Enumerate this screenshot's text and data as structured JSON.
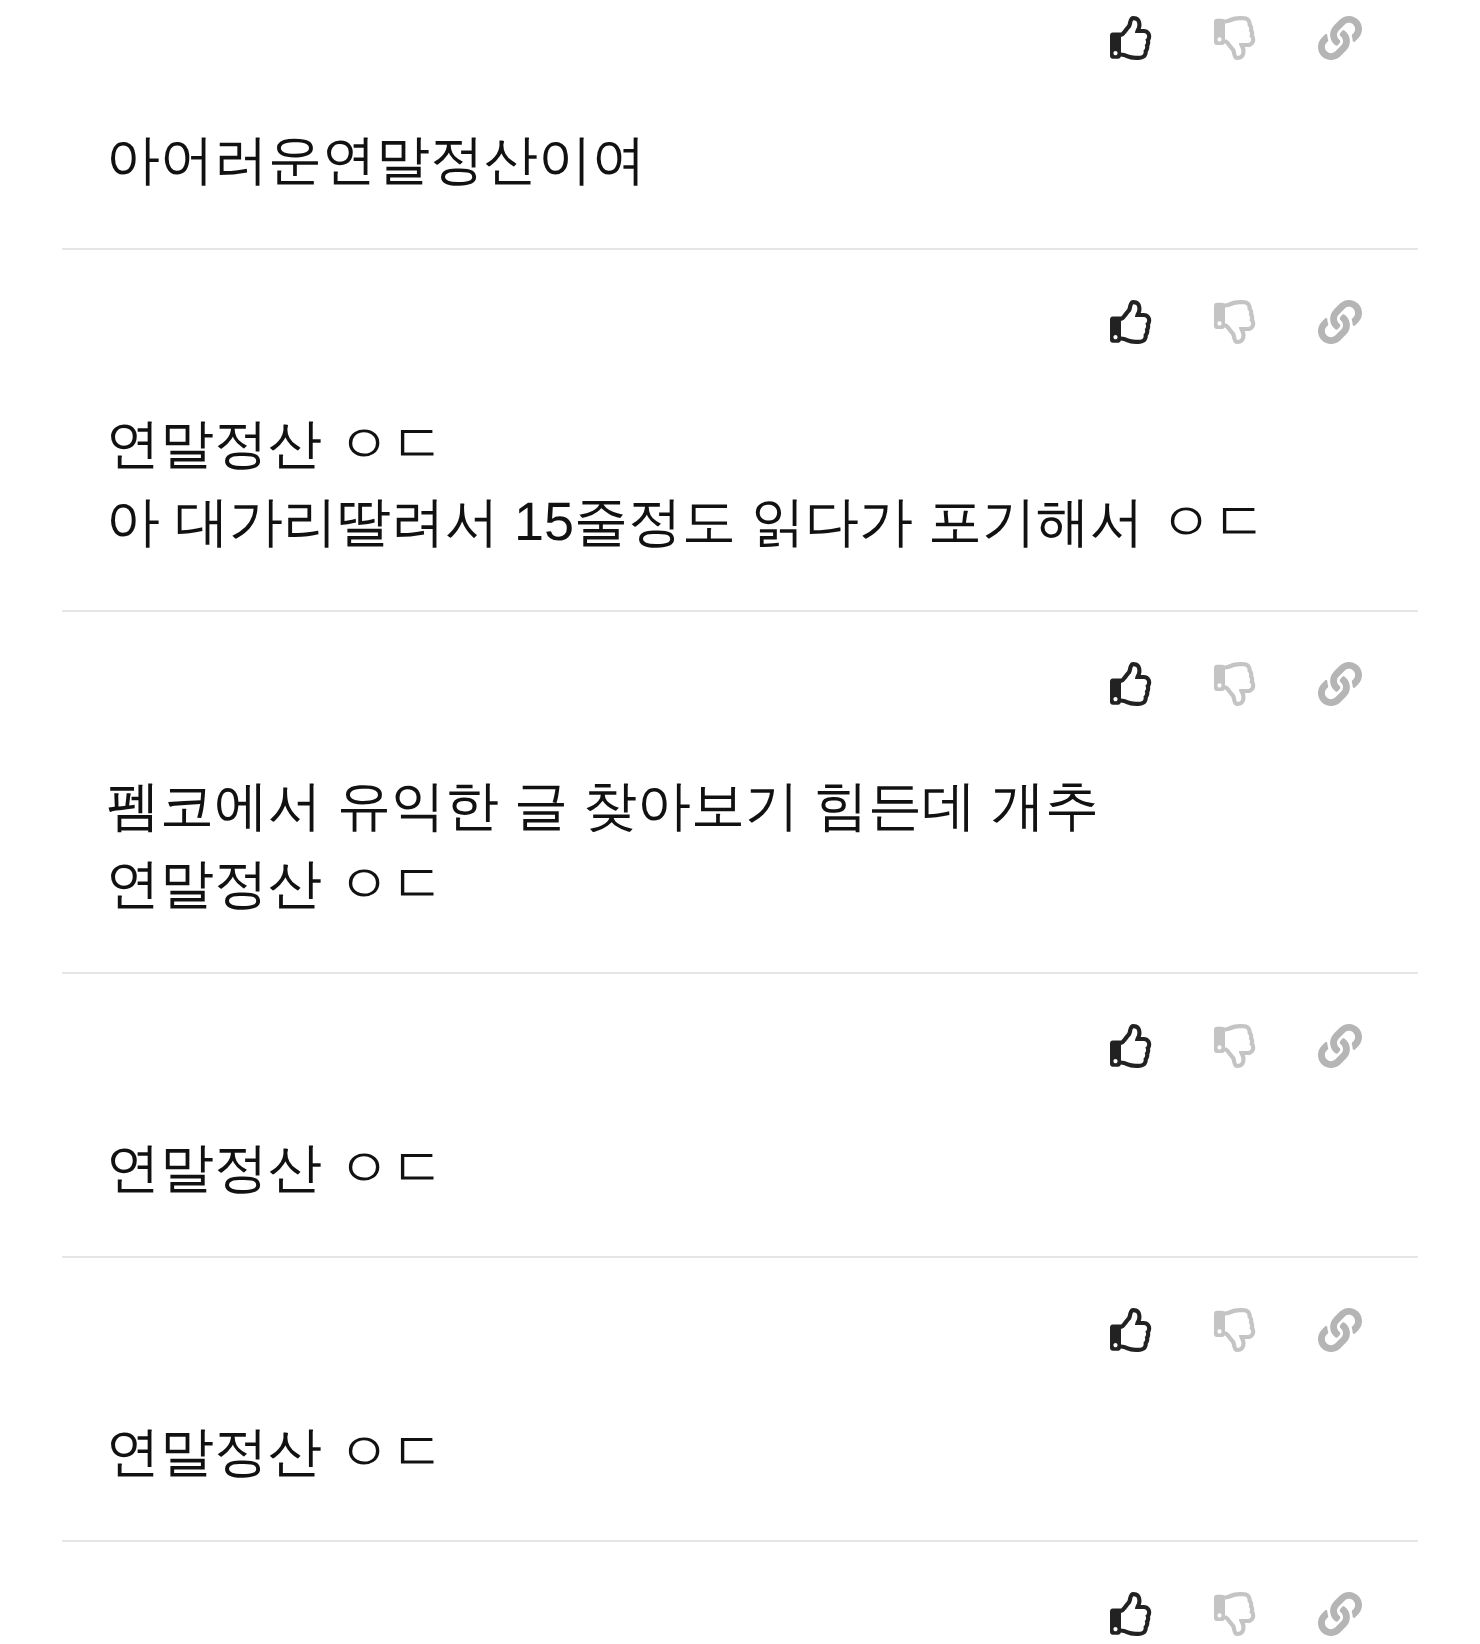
{
  "comments": [
    {
      "text": "아어러운연말정산이여"
    },
    {
      "text": "연말정산 ㅇㄷ\n아 대가리딸려서 15줄정도 읽다가 포기해서 ㅇㄷ"
    },
    {
      "text": "펨코에서 유익한 글 찾아보기 힘든데 개추\n연말정산 ㅇㄷ"
    },
    {
      "text": "연말정산 ㅇㄷ"
    },
    {
      "text": "연말정산 ㅇㄷ"
    }
  ]
}
